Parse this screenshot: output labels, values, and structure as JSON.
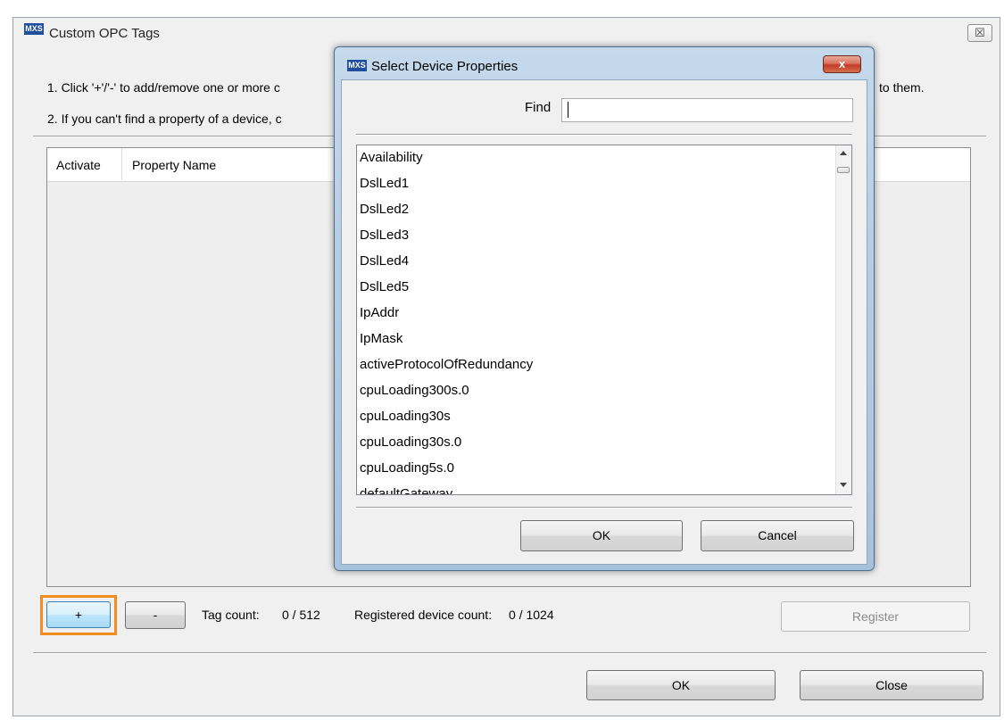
{
  "main_window": {
    "title": "Custom OPC Tags",
    "logo": "MXS",
    "close_glyph": "☒",
    "instruction_1": "1. Click '+'/'-' to add/remove one or more c",
    "instruction_1_tail": "to them.",
    "instruction_2": "2. If you can't find a property of a device, c"
  },
  "table": {
    "columns": [
      "Activate",
      "Property Name"
    ]
  },
  "controls": {
    "add_label": "+",
    "remove_label": "-",
    "tag_count_label": "Tag count:",
    "tag_count_value": "0 / 512",
    "device_count_label": "Registered device count:",
    "device_count_value": "0 / 1024",
    "register_label": "Register",
    "ok_label": "OK",
    "close_label": "Close"
  },
  "dialog": {
    "title": "Select Device Properties",
    "logo": "MXS",
    "close_glyph": "x",
    "find_label": "Find",
    "find_value": "",
    "items": [
      "Availability",
      "DslLed1",
      "DslLed2",
      "DslLed3",
      "DslLed4",
      "DslLed5",
      "IpAddr",
      "IpMask",
      "activeProtocolOfRedundancy",
      "cpuLoading300s.0",
      "cpuLoading30s",
      "cpuLoading30s.0",
      "cpuLoading5s.0",
      "defaultGateway"
    ],
    "ok_label": "OK",
    "cancel_label": "Cancel"
  },
  "colors": {
    "highlight_border": "#f28c1f",
    "dialog_frame": "#b7cde3",
    "close_button_red": "#c4392a"
  },
  "icons": [
    "app-logo-icon",
    "close-icon",
    "scroll-up-icon",
    "scroll-down-icon"
  ]
}
